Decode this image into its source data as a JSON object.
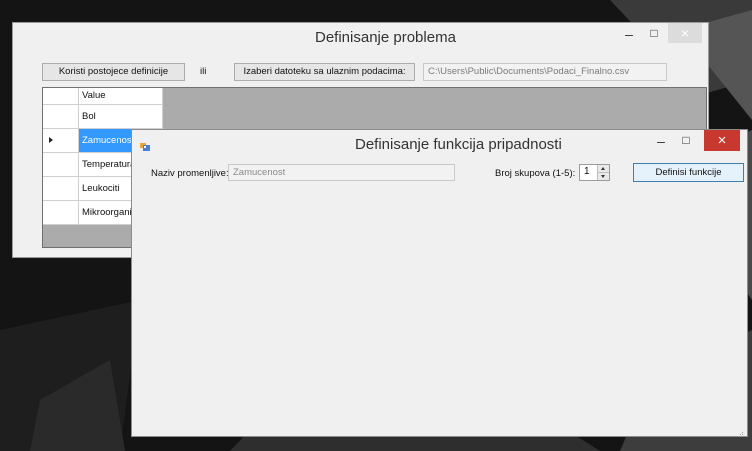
{
  "main_window": {
    "title": "Definisanje problema",
    "use_existing_button": "Koristi postojece definicije",
    "or_label": "ili",
    "choose_file_button": "Izaberi datoteku sa ulaznim podacima:",
    "file_path": "C:\\Users\\Public\\Documents\\Podaci_Finalno.csv",
    "grid": {
      "header": "Value",
      "rows": [
        "Bol",
        "Zamucenost",
        "Temperatura",
        "Leukociti",
        "Mikroorganiz"
      ],
      "selected_index": 1
    }
  },
  "dialog": {
    "title": "Definisanje funkcija pripadnosti",
    "var_name_label": "Naziv promenljive:",
    "var_name_value": "Zamucenost",
    "sets_label": "Broj skupova (1-5):",
    "sets_value": "1",
    "define_button": "Definisi funkcije"
  },
  "window_controls": {
    "minimize": "–",
    "maximize": "□",
    "close": "×"
  },
  "colors": {
    "close_red": "#c7392f",
    "selection": "#3399ff",
    "grid_bg": "#ababab"
  },
  "icons": [
    "app-icon",
    "row-pointer-icon",
    "spin-up-icon",
    "spin-down-icon",
    "size-grip-icon"
  ]
}
